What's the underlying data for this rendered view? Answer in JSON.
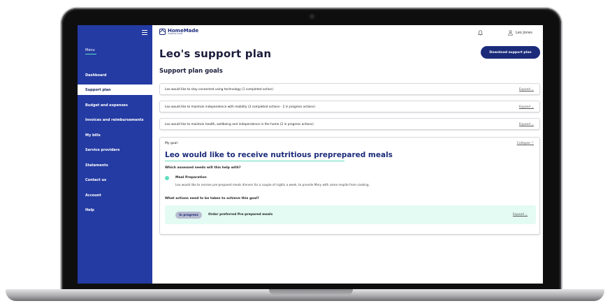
{
  "app": {
    "logo_name": "HomeMade",
    "logo_sub": "Customer portal",
    "user_name": "Leo Jones"
  },
  "sidebar": {
    "menu_label": "Menu",
    "items": [
      {
        "label": "Dashboard",
        "active": false
      },
      {
        "label": "Support plan",
        "active": true
      },
      {
        "label": "Budget and expenses",
        "active": false
      },
      {
        "label": "Invoices and reimbursements",
        "active": false
      },
      {
        "label": "My bills",
        "active": false
      },
      {
        "label": "Service providers",
        "active": false
      },
      {
        "label": "Statements",
        "active": false
      },
      {
        "label": "Contact us",
        "active": false
      },
      {
        "label": "Account",
        "active": false
      },
      {
        "label": "Help",
        "active": false
      }
    ]
  },
  "main": {
    "page_title": "Leo's support plan",
    "download_label": "Download support plan",
    "section_title": "Support plan goals",
    "goals": [
      {
        "text": "Leo would like to stay connected using technology (1 completed action)",
        "link": "Expand"
      },
      {
        "text": "Leo would like to maintain independence with mobility (2 completed actions - 2 in progress actions)",
        "link": "Expand"
      },
      {
        "text": "Leo would like to maintain health, wellbeing and independence in the home (2 in progress actions)",
        "link": "Expand"
      }
    ],
    "expanded_goal": {
      "label": "My goal:",
      "collapse": "Collapse",
      "heading": "Leo would like to receive nutritious preprepared meals",
      "question_needs": "Which assessed needs will this help with?",
      "need_title": "Meal Preparation",
      "need_desc": "Leo would like to receive pre-prepared meals dinners for a couple of nights a week, to provide Mary with some respite from cooking.",
      "question_actions": "What actions need to be taken to achieve this goal?",
      "action": {
        "status": "In progress",
        "text": "Order preferred Pre-prepared meals",
        "link": "Expand"
      }
    }
  },
  "colors": {
    "sidebar": "#243ba3",
    "accent": "#5de0c0",
    "brand": "#1b2b7a",
    "action_bg": "#e3fbf3"
  }
}
